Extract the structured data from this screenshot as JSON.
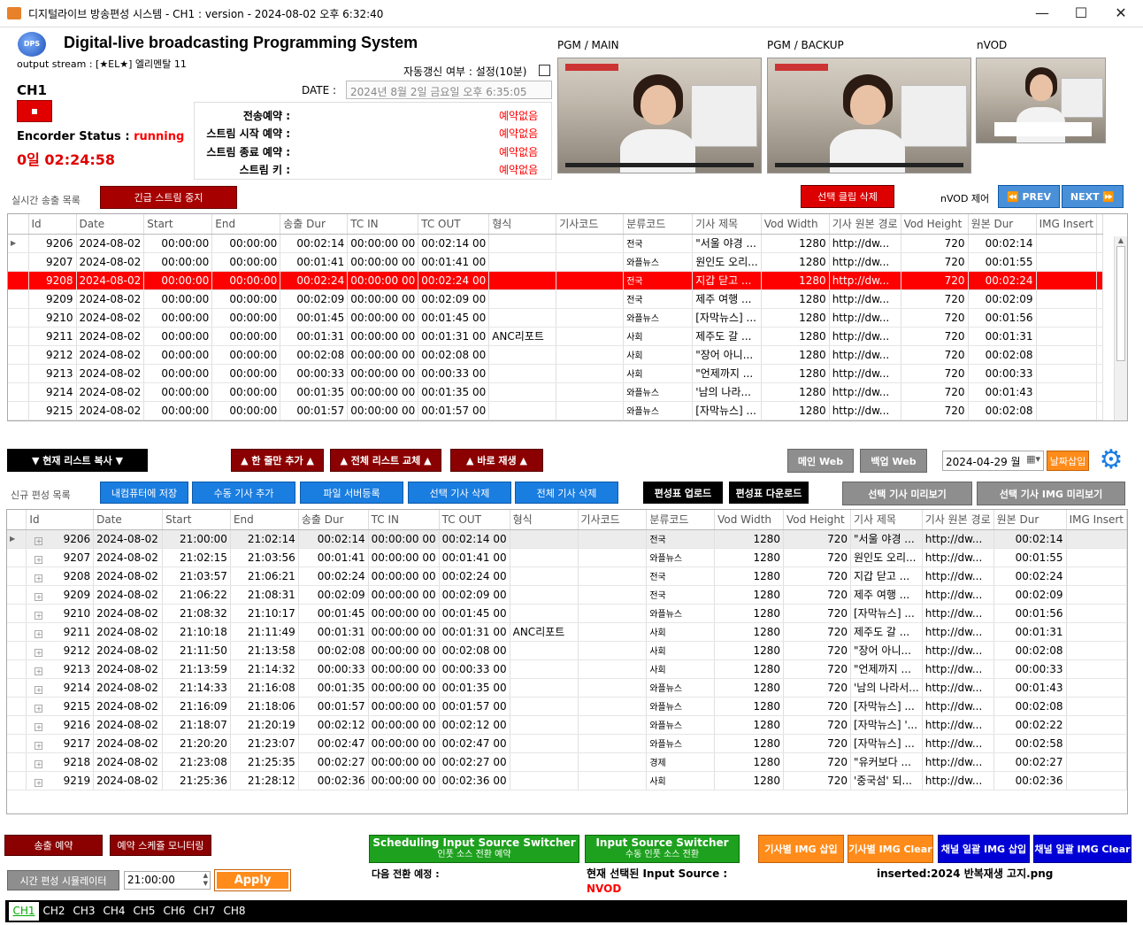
{
  "window": {
    "title": "디지털라이브 방송편성 시스템 - CH1 : version - 2024-08-02 오후 6:32:40"
  },
  "header": {
    "logo_text": "DPS",
    "app_title": "Digital-live broadcasting Programming System",
    "output_stream": "output stream : [★EL★] 엘리멘탈 11",
    "channel": "CH1",
    "encoder_label": "Encorder Status :",
    "encoder_status": "running",
    "uptime": "0일 02:24:58",
    "auto_refresh_label": "자동갱신 여부 : 설정(10분)",
    "date_label": "DATE :",
    "date_value": "2024년 8월 2일 금요일 오후 6:35:05",
    "reservations": [
      {
        "label": "전송예약 :",
        "value": "예약없음"
      },
      {
        "label": "스트림 시작 예약 :",
        "value": "예약없음"
      },
      {
        "label": "스트림 종료 예약 :",
        "value": "예약없음"
      },
      {
        "label": "스트림 키 :",
        "value": "예약없음"
      }
    ],
    "previews": {
      "main": "PGM / MAIN",
      "backup": "PGM / BACKUP",
      "nvod": "nVOD"
    }
  },
  "live": {
    "section_label": "실시간 송출 목록",
    "emergency_button": "긴급 스트림 중지",
    "delete_clip_button": "선택 클립 삭제",
    "nvod_control_label": "nVOD 제어",
    "prev_button": "PREV",
    "next_button": "NEXT",
    "columns": [
      "Id",
      "Date",
      "Start",
      "End",
      "송출 Dur",
      "TC IN",
      "TC OUT",
      "형식",
      "기사코드",
      "분류코드",
      "기사 제목",
      "Vod Width",
      "기사 원본 경로",
      "Vod Height",
      "원본 Dur",
      "IMG Insert"
    ],
    "rows": [
      [
        "9206",
        "2024-08-02",
        "00:00:00",
        "00:00:00",
        "00:02:14",
        "00:00:00 00",
        "00:02:14 00",
        "",
        "",
        "전국",
        "\"서울 야경 ...",
        "1280",
        "http://dw...",
        "720",
        "00:02:14",
        ""
      ],
      [
        "9207",
        "2024-08-02",
        "00:00:00",
        "00:00:00",
        "00:01:41",
        "00:00:00 00",
        "00:01:41 00",
        "",
        "",
        "와플뉴스",
        "원인도 오리...",
        "1280",
        "http://dw...",
        "720",
        "00:01:55",
        ""
      ],
      [
        "9208",
        "2024-08-02",
        "00:00:00",
        "00:00:00",
        "00:02:24",
        "00:00:00 00",
        "00:02:24 00",
        "",
        "",
        "전국",
        "지갑 닫고 ...",
        "1280",
        "http://dw...",
        "720",
        "00:02:24",
        ""
      ],
      [
        "9209",
        "2024-08-02",
        "00:00:00",
        "00:00:00",
        "00:02:09",
        "00:00:00 00",
        "00:02:09 00",
        "",
        "",
        "전국",
        "제주 여행 ...",
        "1280",
        "http://dw...",
        "720",
        "00:02:09",
        ""
      ],
      [
        "9210",
        "2024-08-02",
        "00:00:00",
        "00:00:00",
        "00:01:45",
        "00:00:00 00",
        "00:01:45 00",
        "",
        "",
        "와플뉴스",
        "[자막뉴스] ...",
        "1280",
        "http://dw...",
        "720",
        "00:01:56",
        ""
      ],
      [
        "9211",
        "2024-08-02",
        "00:00:00",
        "00:00:00",
        "00:01:31",
        "00:00:00 00",
        "00:01:31 00",
        "ANC리포트",
        "",
        "사회",
        "제주도 갈 ...",
        "1280",
        "http://dw...",
        "720",
        "00:01:31",
        ""
      ],
      [
        "9212",
        "2024-08-02",
        "00:00:00",
        "00:00:00",
        "00:02:08",
        "00:00:00 00",
        "00:02:08 00",
        "",
        "",
        "사회",
        "\"장어 아니...",
        "1280",
        "http://dw...",
        "720",
        "00:02:08",
        ""
      ],
      [
        "9213",
        "2024-08-02",
        "00:00:00",
        "00:00:00",
        "00:00:33",
        "00:00:00 00",
        "00:00:33 00",
        "",
        "",
        "사회",
        "\"언제까지 ...",
        "1280",
        "http://dw...",
        "720",
        "00:00:33",
        ""
      ],
      [
        "9214",
        "2024-08-02",
        "00:00:00",
        "00:00:00",
        "00:01:35",
        "00:00:00 00",
        "00:01:35 00",
        "",
        "",
        "와플뉴스",
        "'남의 나라...",
        "1280",
        "http://dw...",
        "720",
        "00:01:43",
        ""
      ],
      [
        "9215",
        "2024-08-02",
        "00:00:00",
        "00:00:00",
        "00:01:57",
        "00:00:00 00",
        "00:01:57 00",
        "",
        "",
        "와플뉴스",
        "[자막뉴스] ...",
        "1280",
        "http://dw...",
        "720",
        "00:02:08",
        ""
      ]
    ]
  },
  "toolbar": {
    "copy_list": "▼ 현재 리스트 복사 ▼",
    "add_one": "▲ 한 줄만 추가 ▲",
    "replace_all": "▲ 전체 리스트 교체 ▲",
    "play_now": "▲ 바로 재생 ▲",
    "main_web": "메인 Web",
    "backup_web": "백업 Web",
    "date_input": "2024-04-29 월",
    "date_insert": "날짜삽입"
  },
  "schedule": {
    "section_label": "신규 편성 목록",
    "buttons": [
      "내컴퓨터에 저장",
      "수동 기사 추가",
      "파일 서버등록",
      "선택 기사 삭제",
      "전체 기사 삭제"
    ],
    "upload": "편성표 업로드",
    "download": "편성표 다운로드",
    "preview": "선택 기사 미리보기",
    "img_preview": "선택 기사 IMG 미리보기",
    "columns": [
      "Id",
      "Date",
      "Start",
      "End",
      "송출 Dur",
      "TC IN",
      "TC OUT",
      "형식",
      "기사코드",
      "분류코드",
      "Vod Width",
      "Vod Height",
      "기사 제목",
      "기사 원본 경로",
      "원본 Dur",
      "IMG Insert"
    ],
    "rows": [
      [
        "9206",
        "2024-08-02",
        "21:00:00",
        "21:02:14",
        "00:02:14",
        "00:00:00 00",
        "00:02:14 00",
        "",
        "",
        "전국",
        "1280",
        "720",
        "\"서울 야경 ...",
        "http://dw...",
        "00:02:14",
        ""
      ],
      [
        "9207",
        "2024-08-02",
        "21:02:15",
        "21:03:56",
        "00:01:41",
        "00:00:00 00",
        "00:01:41 00",
        "",
        "",
        "와플뉴스",
        "1280",
        "720",
        "원인도 오리...",
        "http://dw...",
        "00:01:55",
        ""
      ],
      [
        "9208",
        "2024-08-02",
        "21:03:57",
        "21:06:21",
        "00:02:24",
        "00:00:00 00",
        "00:02:24 00",
        "",
        "",
        "전국",
        "1280",
        "720",
        "지갑 닫고 ...",
        "http://dw...",
        "00:02:24",
        ""
      ],
      [
        "9209",
        "2024-08-02",
        "21:06:22",
        "21:08:31",
        "00:02:09",
        "00:00:00 00",
        "00:02:09 00",
        "",
        "",
        "전국",
        "1280",
        "720",
        "제주 여행 ...",
        "http://dw...",
        "00:02:09",
        ""
      ],
      [
        "9210",
        "2024-08-02",
        "21:08:32",
        "21:10:17",
        "00:01:45",
        "00:00:00 00",
        "00:01:45 00",
        "",
        "",
        "와플뉴스",
        "1280",
        "720",
        "[자막뉴스] ...",
        "http://dw...",
        "00:01:56",
        ""
      ],
      [
        "9211",
        "2024-08-02",
        "21:10:18",
        "21:11:49",
        "00:01:31",
        "00:00:00 00",
        "00:01:31 00",
        "ANC리포트",
        "",
        "사회",
        "1280",
        "720",
        "제주도 갈 ...",
        "http://dw...",
        "00:01:31",
        ""
      ],
      [
        "9212",
        "2024-08-02",
        "21:11:50",
        "21:13:58",
        "00:02:08",
        "00:00:00 00",
        "00:02:08 00",
        "",
        "",
        "사회",
        "1280",
        "720",
        "\"장어 아니...",
        "http://dw...",
        "00:02:08",
        ""
      ],
      [
        "9213",
        "2024-08-02",
        "21:13:59",
        "21:14:32",
        "00:00:33",
        "00:00:00 00",
        "00:00:33 00",
        "",
        "",
        "사회",
        "1280",
        "720",
        "\"언제까지 ...",
        "http://dw...",
        "00:00:33",
        ""
      ],
      [
        "9214",
        "2024-08-02",
        "21:14:33",
        "21:16:08",
        "00:01:35",
        "00:00:00 00",
        "00:01:35 00",
        "",
        "",
        "와플뉴스",
        "1280",
        "720",
        "'남의 나라서...",
        "http://dw...",
        "00:01:43",
        ""
      ],
      [
        "9215",
        "2024-08-02",
        "21:16:09",
        "21:18:06",
        "00:01:57",
        "00:00:00 00",
        "00:01:57 00",
        "",
        "",
        "와플뉴스",
        "1280",
        "720",
        "[자막뉴스] ...",
        "http://dw...",
        "00:02:08",
        ""
      ],
      [
        "9216",
        "2024-08-02",
        "21:18:07",
        "21:20:19",
        "00:02:12",
        "00:00:00 00",
        "00:02:12 00",
        "",
        "",
        "와플뉴스",
        "1280",
        "720",
        "[자막뉴스] '...",
        "http://dw...",
        "00:02:22",
        ""
      ],
      [
        "9217",
        "2024-08-02",
        "21:20:20",
        "21:23:07",
        "00:02:47",
        "00:00:00 00",
        "00:02:47 00",
        "",
        "",
        "와플뉴스",
        "1280",
        "720",
        "[자막뉴스] ...",
        "http://dw...",
        "00:02:58",
        ""
      ],
      [
        "9218",
        "2024-08-02",
        "21:23:08",
        "21:25:35",
        "00:02:27",
        "00:00:00 00",
        "00:02:27 00",
        "",
        "",
        "경제",
        "1280",
        "720",
        "\"유커보다 ...",
        "http://dw...",
        "00:02:27",
        ""
      ],
      [
        "9219",
        "2024-08-02",
        "21:25:36",
        "21:28:12",
        "00:02:36",
        "00:00:00 00",
        "00:02:36 00",
        "",
        "",
        "사회",
        "1280",
        "720",
        "'중국섬' 되...",
        "http://dw...",
        "00:02:36",
        ""
      ]
    ]
  },
  "bottom": {
    "send_reserve": "송출 예약",
    "schedule_monitor": "예약 스케쥴 모니터링",
    "time_sim": "시간 편성 시뮬레이터",
    "time_value": "21:00:00",
    "apply": "Apply",
    "sched_switcher_1": "Scheduling Input Source Switcher",
    "sched_switcher_2": "인풋 소스 전환 예약",
    "switcher_1": "Input Source Switcher",
    "switcher_2": "수동 인풋 소스 전환",
    "next_switch": "다음 전환 예정 :",
    "current_source_label": "현재 선택된 Input Source :",
    "current_source_value": "NVOD",
    "img_insert_per": "기사별 IMG 삽입",
    "img_clear_per": "기사별 IMG Clear",
    "img_insert_all": "채널 일괄 IMG 삽입",
    "img_clear_all": "채널 일괄 IMG Clear",
    "inserted": "inserted:2024 반복재생 고지.png"
  },
  "channels": [
    "CH1",
    "CH2",
    "CH3",
    "CH4",
    "CH5",
    "CH6",
    "CH7",
    "CH8"
  ],
  "colors": {
    "red_status": "#ff0000",
    "accent_blue": "#1a7de0",
    "selected_row": "#ff0000"
  }
}
